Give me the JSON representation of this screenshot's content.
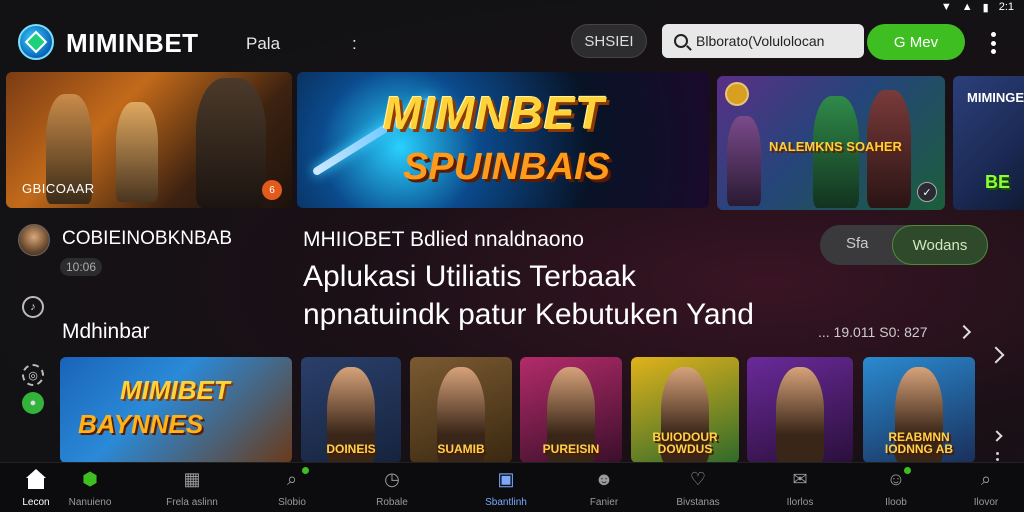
{
  "statusbar": {
    "time": "2:1",
    "signal": "▼",
    "wifi": "▲",
    "battery": "▮"
  },
  "header": {
    "brand": "MIMINBET",
    "menu_label": "Pala",
    "menu_colon": ":",
    "pill_button": "SHSIEI",
    "search_value": "Blborato(Volulolocan",
    "go_button": "G Mev"
  },
  "banners": {
    "b1_caption": "GBICOAAR",
    "b1_badge": "6",
    "b2_title": "MIMNBET",
    "b2_subtitle": "SPUINBAIS",
    "b3_title": "NALEMKNS SOAHER",
    "b3_check": "✓",
    "b4_title": "MIMINGE",
    "b4_tag": "BE"
  },
  "profile": {
    "name": "COBIEINOBKNBAB",
    "time": "10:06"
  },
  "section_title": "Mdhinbar",
  "headline": {
    "kicker": "MHIIOBET Bdlied nnaldnaono",
    "line1": "Aplukasi Utiliatis Terbaak",
    "line2": "npnatuindk patur Kebutuken Yand"
  },
  "toggle": {
    "left": "Sfa",
    "right": "Wodans"
  },
  "meta_row": "... 19.011 S0: 827",
  "cards": [
    {
      "title1": "MIMIBET",
      "title2": "BAYNNES"
    },
    {
      "title": "DOINEIS"
    },
    {
      "title": "SUAMIB"
    },
    {
      "title": "PUREISIN"
    },
    {
      "title": "BUIODOUR DOWDUS"
    },
    {
      "title": ""
    },
    {
      "title": "REABMNN IODNNG AB"
    }
  ],
  "bottom_nav": [
    {
      "label": "Lecon",
      "icon": "home-icon"
    },
    {
      "label": "Nanuieno",
      "icon": "shield-icon"
    },
    {
      "label": "Frela aslinn",
      "icon": "grid-icon"
    },
    {
      "label": "Slobio",
      "icon": "search-icon"
    },
    {
      "label": "Robale",
      "icon": "clock-icon"
    },
    {
      "label": "Sbantlinh",
      "icon": "chat-icon"
    },
    {
      "label": "Fanier",
      "icon": "people-icon"
    },
    {
      "label": "Bivstanas",
      "icon": "heart-icon"
    },
    {
      "label": "Ilorlos",
      "icon": "message-icon"
    },
    {
      "label": "Iloob",
      "icon": "user-icon"
    },
    {
      "label": "Ilovor",
      "icon": "search-icon"
    }
  ],
  "colors": {
    "accent_green": "#3fbe22",
    "background": "#121214",
    "headline_gold": "#ffd23a"
  }
}
